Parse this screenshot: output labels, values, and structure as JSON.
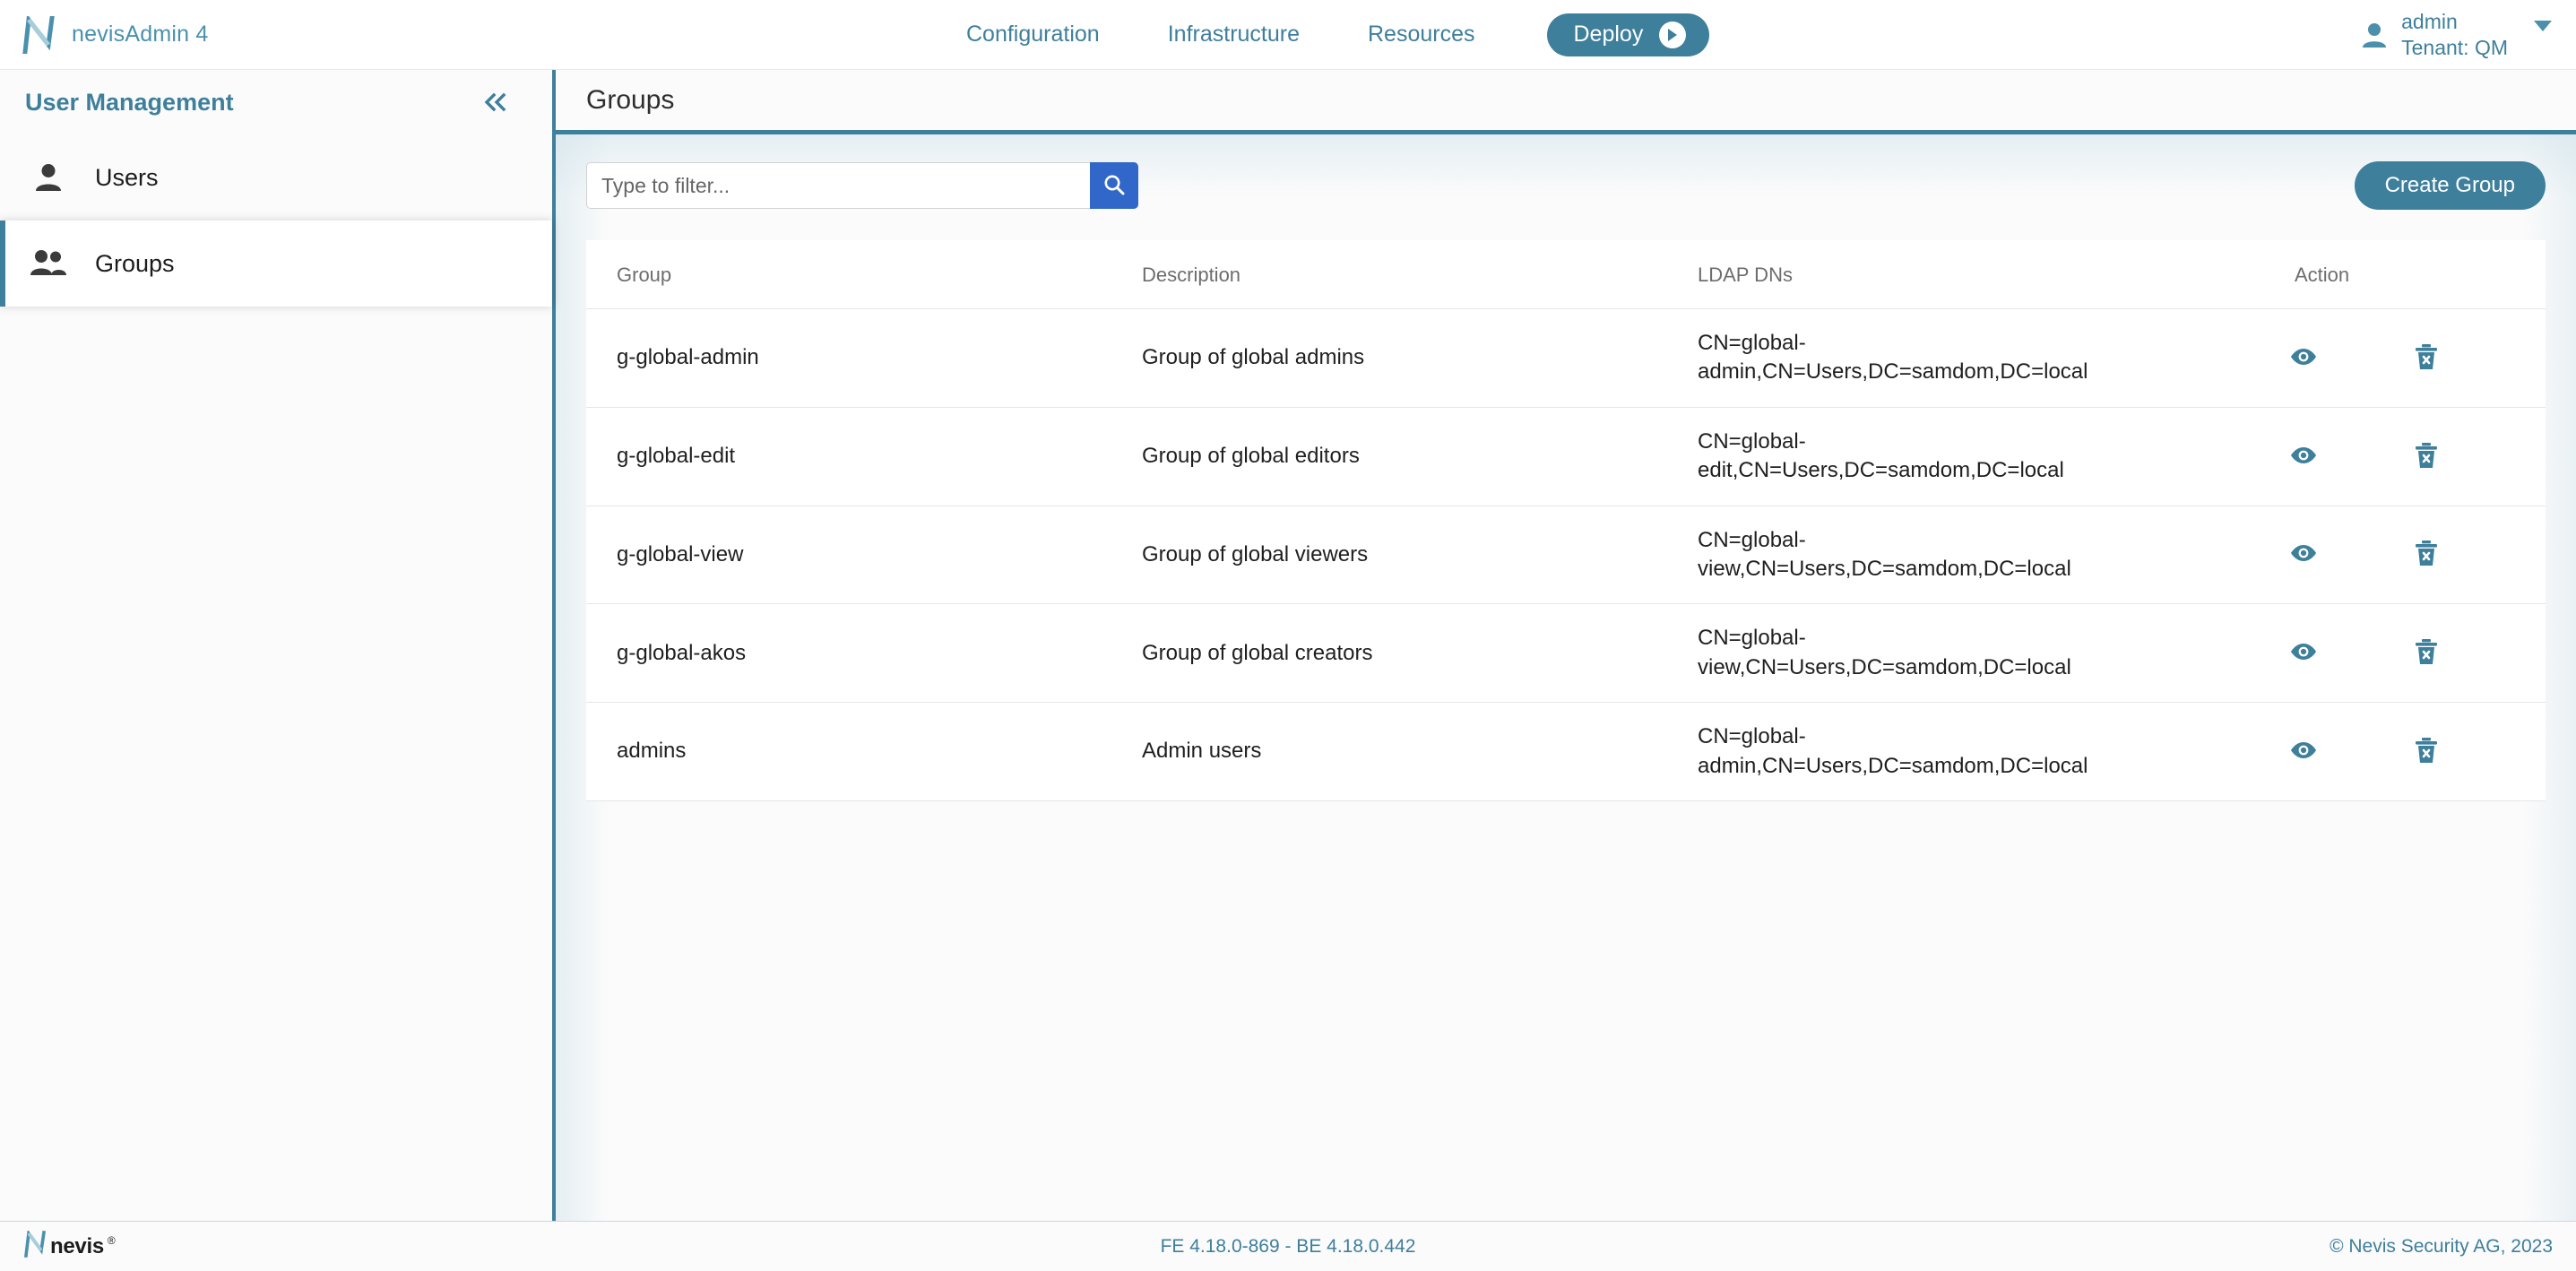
{
  "topbar": {
    "brand_name": "nevisAdmin 4",
    "brand_logo_icon": "nevis-logo-icon",
    "nav": [
      {
        "label": "Configuration"
      },
      {
        "label": "Infrastructure"
      },
      {
        "label": "Resources"
      }
    ],
    "deploy_label": "Deploy",
    "deploy_icon": "play-circle-icon",
    "account": {
      "avatar_icon": "user-avatar-icon",
      "user": "admin",
      "tenant": "Tenant: QM",
      "caret_icon": "chevron-down-icon"
    }
  },
  "sidebar": {
    "title": "User Management",
    "collapse_icon": "double-chevron-left-icon",
    "items": [
      {
        "label": "Users",
        "icon": "single-user-icon",
        "active": false
      },
      {
        "label": "Groups",
        "icon": "multiple-users-icon",
        "active": true
      }
    ]
  },
  "page": {
    "title": "Groups"
  },
  "toolbar": {
    "filter_placeholder": "Type to filter...",
    "filter_value": "",
    "search_icon": "search-icon",
    "create_label": "Create Group"
  },
  "table": {
    "columns": [
      "Group",
      "Description",
      "LDAP DNs",
      "Action"
    ],
    "row_actions": {
      "view_icon": "eye-icon",
      "delete_icon": "trash-delete-icon"
    },
    "rows": [
      {
        "group": "g-global-admin",
        "description": "Group of global admins",
        "ldap_dn": "CN=global-admin,CN=Users,DC=samdom,DC=local"
      },
      {
        "group": "g-global-edit",
        "description": "Group of global editors",
        "ldap_dn": "CN=global-edit,CN=Users,DC=samdom,DC=local"
      },
      {
        "group": "g-global-view",
        "description": "Group of global viewers",
        "ldap_dn": "CN=global-view,CN=Users,DC=samdom,DC=local"
      },
      {
        "group": "g-global-akos",
        "description": "Group of global creators",
        "ldap_dn": "CN=global-view,CN=Users,DC=samdom,DC=local"
      },
      {
        "group": "admins",
        "description": "Admin users",
        "ldap_dn": "CN=global-admin,CN=Users,DC=samdom,DC=local"
      }
    ]
  },
  "footer": {
    "logo_icon": "nevis-logo-icon",
    "logo_text": "nevis",
    "versions": "FE 4.18.0-869 - BE 4.18.0.442",
    "copyright": "© Nevis Security AG, 2023"
  },
  "colors": {
    "teal": "#3e7f9c",
    "search_blue": "#3167c8",
    "page_bg": "#fbfbfb",
    "table_bg": "#ffffff"
  }
}
